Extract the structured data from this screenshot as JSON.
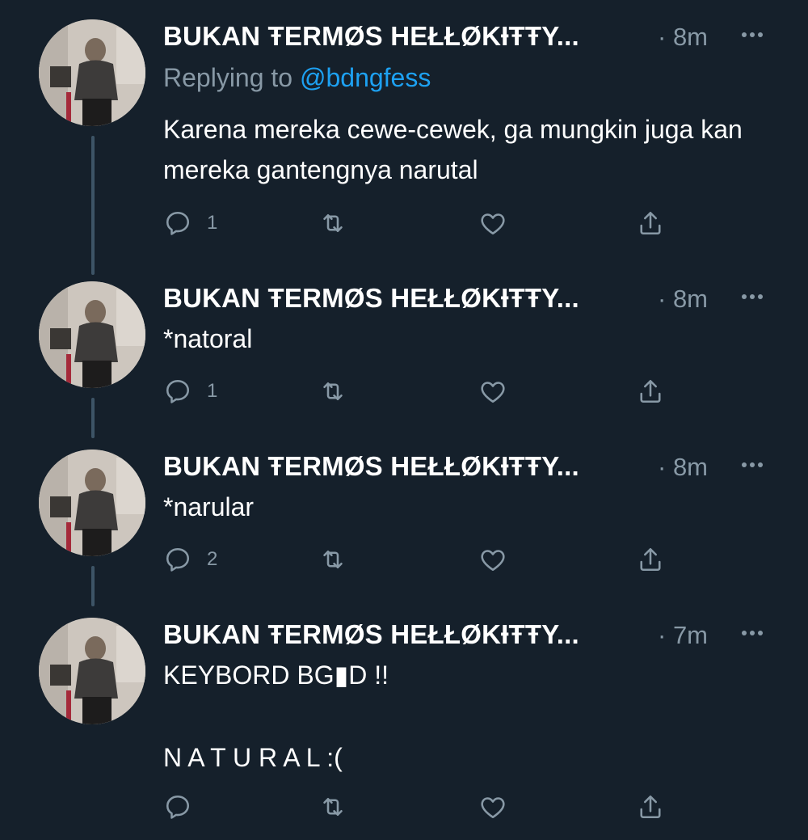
{
  "colors": {
    "background": "#15202b",
    "text_primary": "#ffffff",
    "text_secondary": "#8899a6",
    "link": "#1da1f2",
    "thread_line": "#3d5466"
  },
  "icons": {
    "reply": "reply-icon",
    "retweet": "retweet-icon",
    "like": "heart-icon",
    "share": "share-icon",
    "more": "more-options-icon"
  },
  "tweets": [
    {
      "display_name": "BUKAN ŦERMØS HEŁŁØKƗŦŦY...",
      "time": "8m",
      "replying_prefix": "Replying to",
      "replying_handle": "@bdngfess",
      "text": "Karena mereka cewe-cewek, ga mungkin juga kan mereka gantengnya narutal",
      "reply_count": "1"
    },
    {
      "display_name": "BUKAN ŦERMØS HEŁŁØKƗŦŦY...",
      "time": "8m",
      "text": "*natoral",
      "reply_count": "1"
    },
    {
      "display_name": "BUKAN ŦERMØS HEŁŁØKƗŦŦY...",
      "time": "8m",
      "text": "*narular",
      "reply_count": "2"
    },
    {
      "display_name": "BUKAN ŦERMØS HEŁŁØKƗŦŦY...",
      "time": "7m",
      "text_line1": "KEYBORD BG▮D !!",
      "text_line2": "N A T U R A L :(",
      "reply_count": ""
    }
  ]
}
